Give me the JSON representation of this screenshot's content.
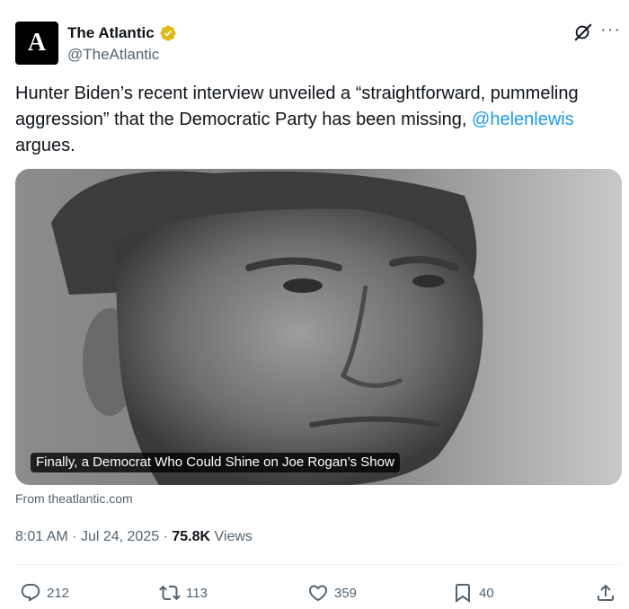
{
  "author": {
    "avatar_letter": "A",
    "display_name": "The Atlantic",
    "handle": "@TheAtlantic",
    "verified_color": "#e2b719"
  },
  "tweet": {
    "text_before": "Hunter Biden’s recent interview unveiled a “straightforward, pummeling aggression” that the Democratic Party has been missing, ",
    "mention": "@helenlewis",
    "text_after": " argues."
  },
  "media": {
    "caption": "Finally, a Democrat Who Could Shine on Joe Rogan’s Show",
    "source": "From theatlantic.com"
  },
  "meta": {
    "time": "8:01 AM",
    "date": "Jul 24, 2025",
    "separator": "·",
    "views_count": "75.8K",
    "views_label": "Views"
  },
  "actions": {
    "reply_count": "212",
    "repost_count": "113",
    "like_count": "359",
    "bookmark_count": "40"
  },
  "icons": {
    "grok": "grok-icon",
    "more": "more-icon",
    "reply": "reply-icon",
    "repost": "repost-icon",
    "like": "heart-icon",
    "bookmark": "bookmark-icon",
    "share": "share-icon"
  },
  "colors": {
    "text": "#0f1419",
    "secondary": "#536471",
    "link": "#1d9bf0"
  }
}
